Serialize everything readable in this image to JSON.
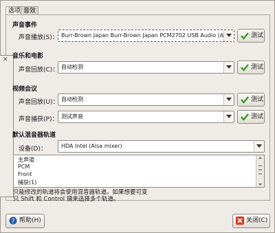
{
  "tabs": [
    {
      "label": "选项",
      "active": true
    },
    {
      "label": "音效",
      "active": false
    }
  ],
  "sound_events": {
    "heading": "声音事件",
    "label": "声音播放(S)：",
    "value": "Burr-Brown Japan Burr-Brown Japan PCM2702 USB Audio (ALSA)",
    "test_label": "测试"
  },
  "music_movies": {
    "heading": "音乐和电影",
    "label": "声音回放(C)：",
    "value": "自动检测",
    "test_label": "测试"
  },
  "audio_conf": {
    "heading": "视频会议",
    "playback_label": "声音回放(U)：",
    "playback_value": "自动检测",
    "playback_test": "测试",
    "capture_label": "声音捕获(P)：",
    "capture_value": "测试声音",
    "capture_test": "测试"
  },
  "mixer": {
    "heading": "默认混音器轨道",
    "device_label": "设备(D)：",
    "device_value": "HDA Intel (Alsa mixer)",
    "tracks": [
      "主声道",
      "PCM",
      "Front",
      "捕获(1)"
    ]
  },
  "note_line1": "只能修改的轨道将会使用混音器轨道。如果想要可变",
  "note_line2": "只 Shift 和 Control 键来选择多个轨道。",
  "help_label": "帮助(H)",
  "close_label": "关闭(C)",
  "colors": {
    "check_green": "#3a9a1f",
    "close_red": "#d83a1c",
    "help_blue": "#2a5aa8"
  }
}
